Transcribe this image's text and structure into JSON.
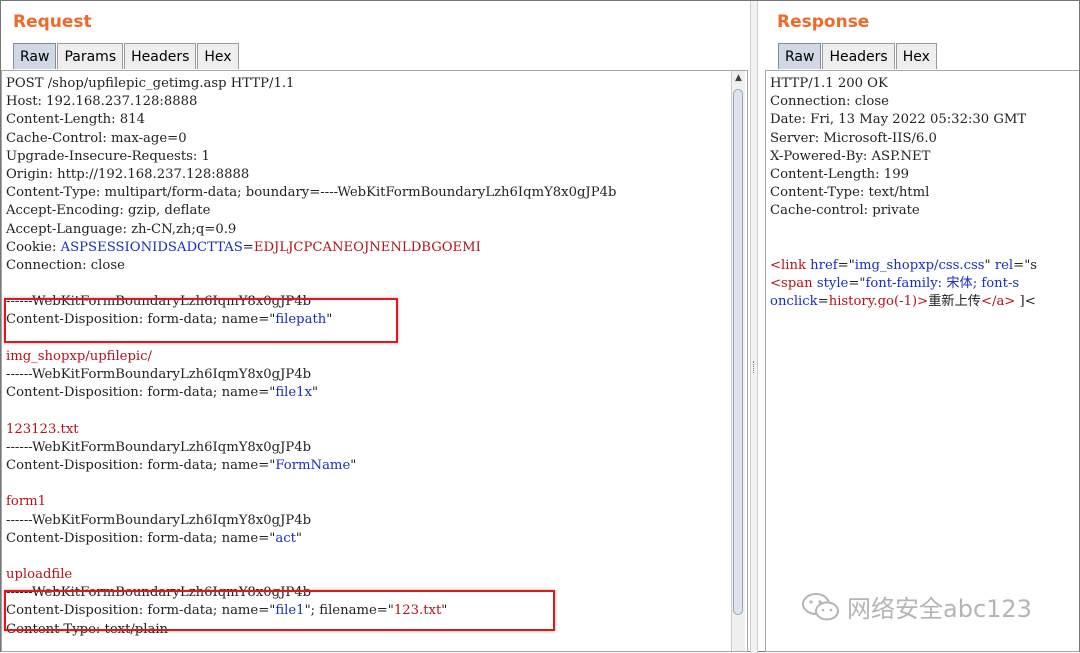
{
  "request": {
    "title": "Request",
    "tabs": [
      "Raw",
      "Params",
      "Headers",
      "Hex"
    ],
    "active_tab": "Raw",
    "lines": [
      [
        {
          "t": "POST /shop/upfilepic_getimg.asp HTTP/1.1",
          "c": "dark"
        }
      ],
      [
        {
          "t": "Host: 192.168.237.128:8888",
          "c": "dark"
        }
      ],
      [
        {
          "t": "Content-Length: 814",
          "c": "dark"
        }
      ],
      [
        {
          "t": "Cache-Control: max-age=0",
          "c": "dark"
        }
      ],
      [
        {
          "t": "Upgrade-Insecure-Requests: 1",
          "c": "dark"
        }
      ],
      [
        {
          "t": "Origin: http://192.168.237.128:8888",
          "c": "dark"
        }
      ],
      [
        {
          "t": "Content-Type: multipart/form-data; boundary=----WebKitFormBoundaryLzh6IqmY8x0gJP4b",
          "c": "dark"
        }
      ],
      [
        {
          "t": "Accept-Encoding: gzip, deflate",
          "c": "dark"
        }
      ],
      [
        {
          "t": "Accept-Language: zh-CN,zh;q=0.9",
          "c": "dark"
        }
      ],
      [
        {
          "t": "Cookie: ",
          "c": "dark"
        },
        {
          "t": "ASPSESSIONIDSADCTTAS",
          "c": "blue"
        },
        {
          "t": "=",
          "c": "dark"
        },
        {
          "t": "EDJLJCPCANEOJNENLDBGOEMI",
          "c": "red"
        }
      ],
      [
        {
          "t": "Connection: close",
          "c": "dark"
        }
      ],
      [
        {
          "t": "",
          "c": "dark"
        }
      ],
      [
        {
          "t": "------WebKitFormBoundaryLzh6IqmY8x0gJP4b",
          "c": "dark"
        }
      ],
      [
        {
          "t": "Content-Disposition: form-data; name=\"",
          "c": "dark"
        },
        {
          "t": "filepath",
          "c": "blue"
        },
        {
          "t": "\"",
          "c": "dark"
        }
      ],
      [
        {
          "t": "",
          "c": "dark"
        }
      ],
      [
        {
          "t": "img_shopxp/upfilepic/",
          "c": "red"
        }
      ],
      [
        {
          "t": "------WebKitFormBoundaryLzh6IqmY8x0gJP4b",
          "c": "dark"
        }
      ],
      [
        {
          "t": "Content-Disposition: form-data; name=\"",
          "c": "dark"
        },
        {
          "t": "file1x",
          "c": "blue"
        },
        {
          "t": "\"",
          "c": "dark"
        }
      ],
      [
        {
          "t": "",
          "c": "dark"
        }
      ],
      [
        {
          "t": "123123.txt",
          "c": "red"
        }
      ],
      [
        {
          "t": "------WebKitFormBoundaryLzh6IqmY8x0gJP4b",
          "c": "dark"
        }
      ],
      [
        {
          "t": "Content-Disposition: form-data; name=\"",
          "c": "dark"
        },
        {
          "t": "FormName",
          "c": "blue"
        },
        {
          "t": "\"",
          "c": "dark"
        }
      ],
      [
        {
          "t": "",
          "c": "dark"
        }
      ],
      [
        {
          "t": "form1",
          "c": "red"
        }
      ],
      [
        {
          "t": "------WebKitFormBoundaryLzh6IqmY8x0gJP4b",
          "c": "dark"
        }
      ],
      [
        {
          "t": "Content-Disposition: form-data; name=\"",
          "c": "dark"
        },
        {
          "t": "act",
          "c": "blue"
        },
        {
          "t": "\"",
          "c": "dark"
        }
      ],
      [
        {
          "t": "",
          "c": "dark"
        }
      ],
      [
        {
          "t": "uploadfile",
          "c": "red"
        }
      ],
      [
        {
          "t": "------WebKitFormBoundaryLzh6IqmY8x0gJP4b",
          "c": "dark"
        }
      ],
      [
        {
          "t": "Content-Disposition: form-data; name=\"",
          "c": "dark"
        },
        {
          "t": "file1",
          "c": "blue"
        },
        {
          "t": "\"; filename=\"",
          "c": "dark"
        },
        {
          "t": "123.txt",
          "c": "red"
        },
        {
          "t": "\"",
          "c": "dark"
        }
      ],
      [
        {
          "t": "Content-Type: text/plain",
          "c": "dark"
        }
      ]
    ]
  },
  "response": {
    "title": "Response",
    "tabs": [
      "Raw",
      "Headers",
      "Hex"
    ],
    "active_tab": "Raw",
    "lines": [
      [
        {
          "t": "HTTP/1.1 200 OK",
          "c": "dark"
        }
      ],
      [
        {
          "t": "Connection: close",
          "c": "dark"
        }
      ],
      [
        {
          "t": "Date: Fri, 13 May 2022 05:32:30 GMT",
          "c": "dark"
        }
      ],
      [
        {
          "t": "Server: Microsoft-IIS/6.0",
          "c": "dark"
        }
      ],
      [
        {
          "t": "X-Powered-By: ASP.NET",
          "c": "dark"
        }
      ],
      [
        {
          "t": "Content-Length: 199",
          "c": "dark"
        }
      ],
      [
        {
          "t": "Content-Type: text/html",
          "c": "dark"
        }
      ],
      [
        {
          "t": "Cache-control: private",
          "c": "dark"
        }
      ],
      [
        {
          "t": "",
          "c": "dark"
        }
      ],
      [
        {
          "t": "",
          "c": "dark"
        }
      ],
      [
        {
          "t": "<link ",
          "c": "red"
        },
        {
          "t": "href",
          "c": "blue"
        },
        {
          "t": "=\"",
          "c": "dark"
        },
        {
          "t": "img_shopxp/css.css",
          "c": "blue"
        },
        {
          "t": "\" ",
          "c": "dark"
        },
        {
          "t": "rel",
          "c": "blue"
        },
        {
          "t": "=\"s",
          "c": "dark"
        }
      ],
      [
        {
          "t": "<span ",
          "c": "red"
        },
        {
          "t": "style",
          "c": "blue"
        },
        {
          "t": "=\"",
          "c": "dark"
        },
        {
          "t": "font-family: 宋体; font-s",
          "c": "blue"
        }
      ],
      [
        {
          "t": "onclick",
          "c": "blue"
        },
        {
          "t": "=",
          "c": "dark"
        },
        {
          "t": "history.go(-1)",
          "c": "red"
        },
        {
          "t": ">",
          "c": "red"
        },
        {
          "t": "重新上传",
          "c": "dark"
        },
        {
          "t": "</a>",
          "c": "red"
        },
        {
          "t": " ]<",
          "c": "dark"
        }
      ]
    ]
  },
  "watermark": {
    "text": "网络安全abc123",
    "icon": "wechat-icon"
  }
}
